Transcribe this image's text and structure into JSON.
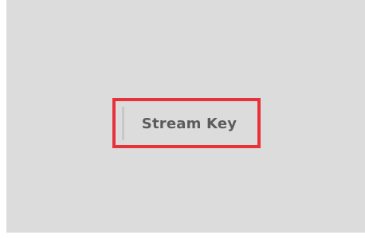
{
  "stream_key_button": {
    "label": "Stream Key"
  },
  "colors": {
    "background": "#dcdcdc",
    "highlight_border": "#e8323a",
    "label_text": "#5c5c5c"
  }
}
